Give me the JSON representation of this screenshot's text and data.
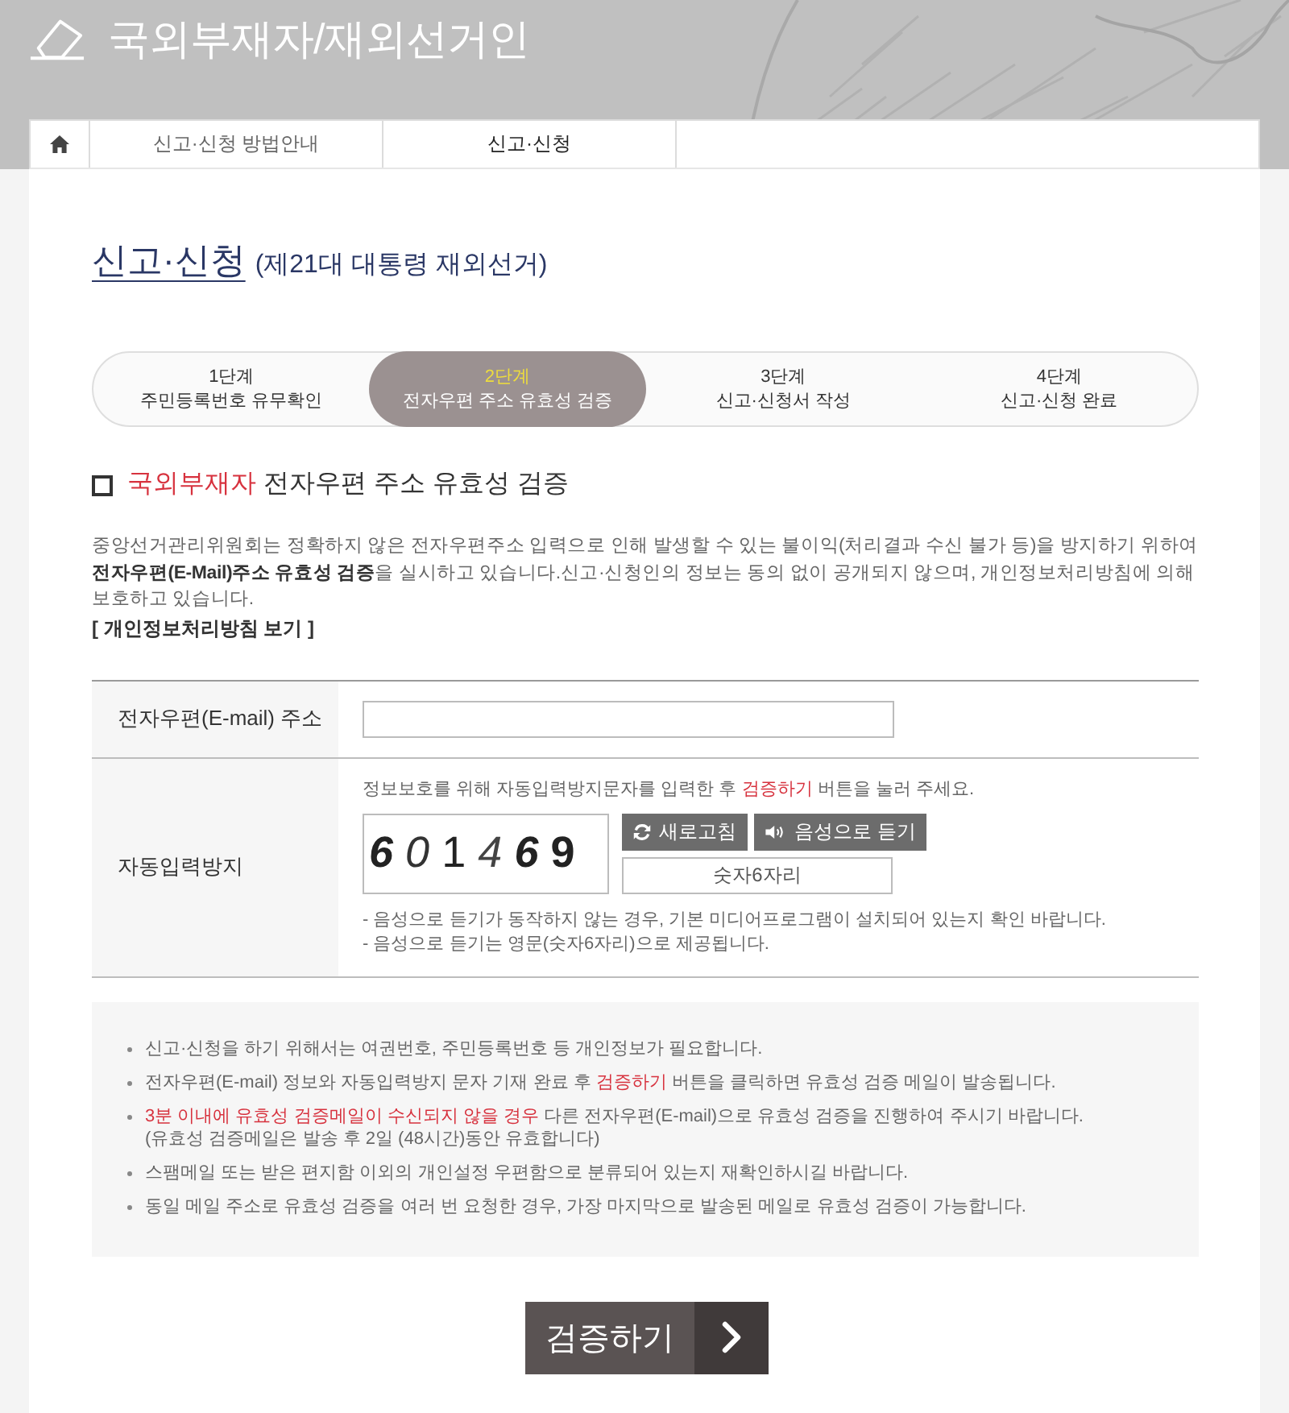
{
  "header": {
    "title": "국외부재자/재외선거인"
  },
  "nav": {
    "items": [
      {
        "label": "신고·신청 방법안내",
        "selected": false
      },
      {
        "label": "신고·신청",
        "selected": true
      }
    ]
  },
  "page_title": {
    "title": "신고·신청",
    "subtitle": "(제21대 대통령 재외선거)"
  },
  "steps": [
    {
      "step": "1단계",
      "label": "주민등록번호 유무확인",
      "selected": false
    },
    {
      "step": "2단계",
      "label": "전자우편 주소 유효성 검증",
      "selected": true
    },
    {
      "step": "3단계",
      "label": "신고·신청서 작성",
      "selected": false
    },
    {
      "step": "4단계",
      "label": "신고·신청 완료",
      "selected": false
    }
  ],
  "section": {
    "heading": [
      {
        "text": "국외부재자",
        "emphasis": true
      },
      {
        "text": " 전자우편 주소 유효성 검증",
        "emphasis": false
      }
    ],
    "intro": "중앙선거관리위원회는 정확하지 않은 전자우편주소 입력으로 인해 발생할 수 있는 불이익(처리결과 수신 불가 등)을 방지하기 위하여 **전자우편(E-Mail)주소 유효성 검증**을 실시하고 있습니다.신고·신청인의 정보는 동의 없이 공개되지 않으며, 개인정보처리방침에 의해 보호하고 있습니다.",
    "privacy_link": "[ 개인정보처리방침 보기 ]"
  },
  "form": {
    "email": {
      "label": "전자우편(E-mail) 주소"
    },
    "captcha": {
      "label": "자동입력방지",
      "hint": [
        {
          "text": "정보보호를 위해 자동입력방지문자를 입력한 후 ",
          "emphasis": false
        },
        {
          "text": "검증하기",
          "emphasis": true
        },
        {
          "text": " 버튼을 눌러 주세요.",
          "emphasis": false
        }
      ],
      "code": "6 0 1 4 6 9",
      "refresh_button": "새로고침",
      "audio_button": "음성으로 듣기",
      "input": {
        "placeholder": "숫자6자리"
      },
      "notes": [
        "- 음성으로 듣기가 동작하지 않는 경우, 기본 미디어프로그램이 설치되어 있는지 확인 바랍니다.",
        "- 음성으로 듣기는 영문(숫자6자리)으로 제공됩니다."
      ]
    }
  },
  "notice": {
    "items": [
      {
        "segments": [
          {
            "text": "신고·신청을 하기 위해서는 여권번호, 주민등록번호 등 개인정보가 필요합니다.",
            "emphasis": false
          }
        ]
      },
      {
        "segments": [
          {
            "text": "전자우편(E-mail) 정보와 자동입력방지 문자 기재 완료 후 ",
            "emphasis": false
          },
          {
            "text": "검증하기",
            "emphasis": true
          },
          {
            "text": " 버튼을 클릭하면 유효성 검증 메일이 발송됩니다.",
            "emphasis": false
          }
        ]
      },
      {
        "segments": [
          {
            "text": "3분 이내에 유효성 검증메일이 수신되지 않을 경우",
            "emphasis": true
          },
          {
            "text": " 다른 전자우편(E-mail)으로 유효성 검증을 진행하여 주시기 바랍니다.",
            "emphasis": false
          }
        ],
        "note": "(유효성 검증메일은 발송 후 2일 (48시간)동안 유효합니다)"
      },
      {
        "segments": [
          {
            "text": "스팸메일 또는 받은 편지함 이외의 개인설정 우편함으로 분류되어 있는지 재확인하시길 바랍니다.",
            "emphasis": false
          }
        ]
      },
      {
        "segments": [
          {
            "text": "동일 메일 주소로 유효성 검증을 여러 번 요청한 경우, 가장 마지막으로 발송된 메일로 유효성 검증이 가능합니다.",
            "emphasis": false
          }
        ]
      }
    ]
  },
  "submit_button": "검증하기"
}
